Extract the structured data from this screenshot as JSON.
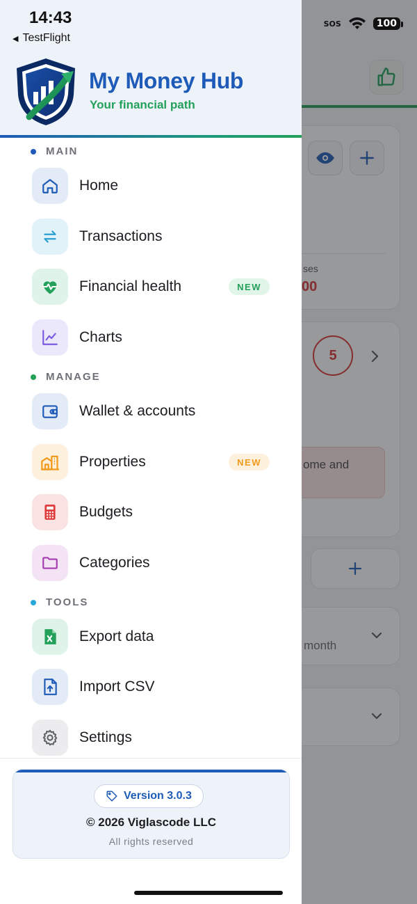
{
  "status_bar": {
    "time": "14:43",
    "back_label": "TestFlight",
    "carrier": "SOS",
    "battery": "100"
  },
  "header": {
    "title": "My Money Hub",
    "subtitle": "Your financial path"
  },
  "sections": [
    {
      "label": "MAIN",
      "color": "#1e5bb8"
    },
    {
      "label": "MANAGE",
      "color": "#23a05a"
    },
    {
      "label": "TOOLS",
      "color": "#2aa8d8"
    }
  ],
  "menu": [
    {
      "label": "Home",
      "icon": "home-icon"
    },
    {
      "label": "Transactions",
      "icon": "arrows-swap-icon"
    },
    {
      "label": "Financial health",
      "icon": "heartbeat-icon",
      "badge": "NEW"
    },
    {
      "label": "Charts",
      "icon": "line-chart-icon"
    },
    {
      "label": "Wallet & accounts",
      "icon": "wallet-icon"
    },
    {
      "label": "Properties",
      "icon": "buildings-icon",
      "badge": "NEW"
    },
    {
      "label": "Budgets",
      "icon": "calculator-icon"
    },
    {
      "label": "Categories",
      "icon": "folder-icon"
    },
    {
      "label": "Export data",
      "icon": "excel-file-icon"
    },
    {
      "label": "Import CSV",
      "icon": "file-upload-icon"
    },
    {
      "label": "Settings",
      "icon": "gear-icon"
    }
  ],
  "footer": {
    "version": "Version 3.0.3",
    "copyright": "© 2026 Viglascode LLC",
    "rights": "All rights reserved"
  },
  "background": {
    "expenses_label": "ses",
    "expenses_value": "00",
    "badge_count": "5",
    "alert_text": "ome and",
    "period_text": "month"
  },
  "colors": {
    "brand_blue": "#1e5bb8",
    "brand_green": "#23a05a",
    "danger": "#d93030",
    "badge_orange": "#f29a1c"
  }
}
